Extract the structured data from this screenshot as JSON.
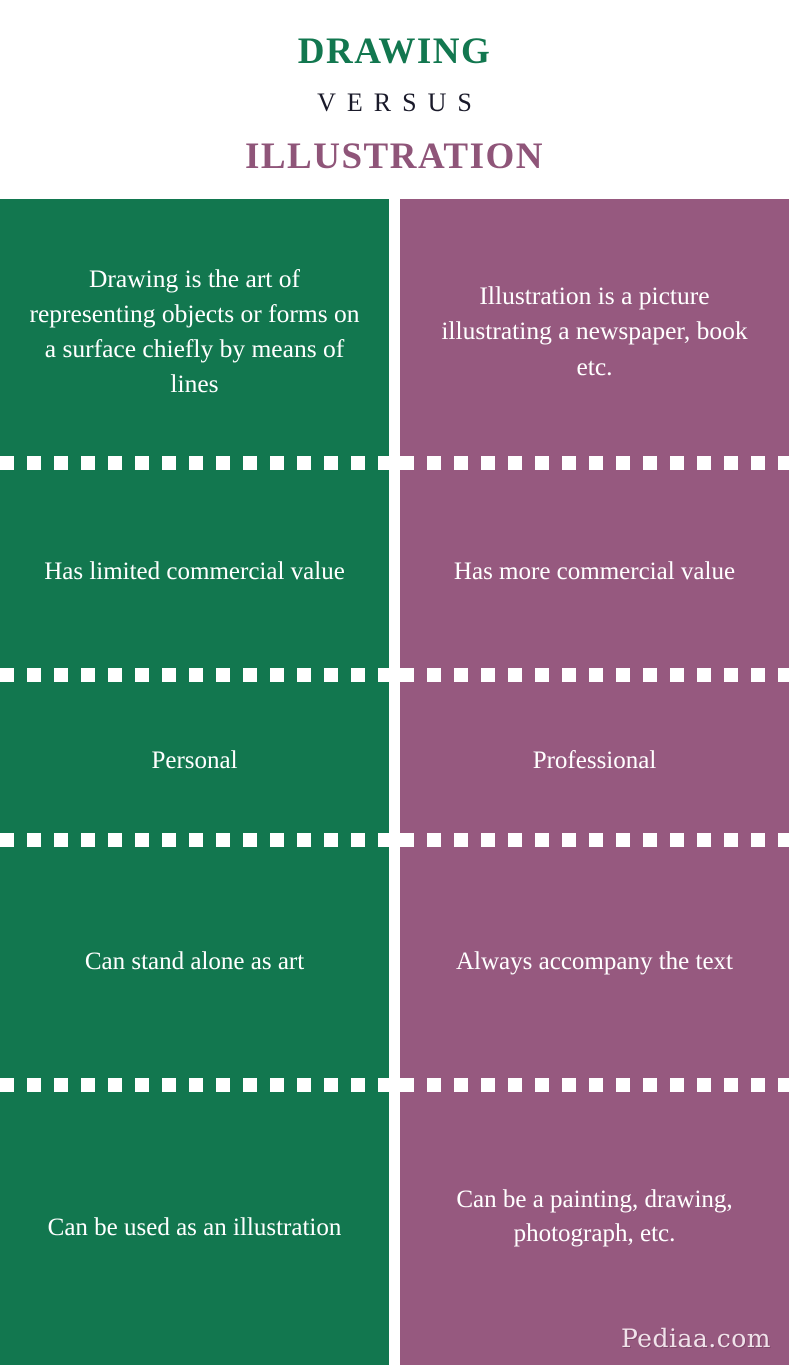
{
  "header": {
    "left_title": "DRAWING",
    "versus": "VERSUS",
    "right_title": "ILLUSTRATION"
  },
  "colors": {
    "left_panel": "#12774f",
    "right_panel": "#96597f",
    "left_title": "#12774f",
    "right_title": "#8f5579",
    "versus_text": "#1a1a2a",
    "text": "#ffffff",
    "background": "#ffffff",
    "dash": "#ffffff"
  },
  "comparison": {
    "left_label": "Drawing",
    "right_label": "Illustration",
    "rows": [
      {
        "left": "Drawing is the art of representing objects or forms on a surface chiefly by means of lines",
        "right": "Illustration is a picture illustrating a newspaper, book etc."
      },
      {
        "left": "Has limited commercial value",
        "right": "Has more commercial value"
      },
      {
        "left": "Personal",
        "right": "Professional"
      },
      {
        "left": "Can stand alone as art",
        "right": "Always accompany the text"
      },
      {
        "left": "Can be used as an illustration",
        "right": "Can be a painting, drawing, photograph, etc."
      }
    ]
  },
  "watermark": "Pediaa.com"
}
